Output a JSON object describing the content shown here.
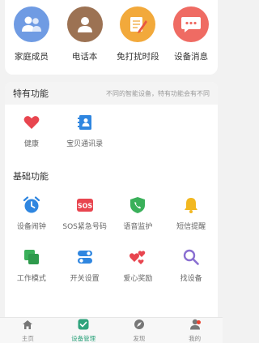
{
  "top_items": [
    {
      "label": "家庭成员",
      "icon": "family-members-icon",
      "color": "#6f9be3"
    },
    {
      "label": "电话本",
      "icon": "phonebook-icon",
      "color": "#9c7253"
    },
    {
      "label": "免打扰时段",
      "icon": "do-not-disturb-icon",
      "color": "#f2a93b"
    },
    {
      "label": "设备消息",
      "icon": "device-message-icon",
      "color": "#ef6b63"
    }
  ],
  "special": {
    "title": "特有功能",
    "desc": "不同的智能设备，特有功能会有不同",
    "items": [
      {
        "label": "健康",
        "icon": "heart-icon"
      },
      {
        "label": "宝贝通讯录",
        "icon": "contacts-book-icon"
      }
    ]
  },
  "basic": {
    "title": "基础功能",
    "items": [
      {
        "label": "设备闹钟",
        "icon": "alarm-clock-icon"
      },
      {
        "label": "SOS紧急号码",
        "icon": "sos-icon"
      },
      {
        "label": "语音监护",
        "icon": "voice-monitor-icon"
      },
      {
        "label": "短信提醒",
        "icon": "bell-icon"
      },
      {
        "label": "工作模式",
        "icon": "work-mode-icon"
      },
      {
        "label": "开关设置",
        "icon": "toggle-switch-icon"
      },
      {
        "label": "爱心奖励",
        "icon": "love-reward-icon"
      },
      {
        "label": "找设备",
        "icon": "search-icon"
      }
    ]
  },
  "tabs": [
    {
      "label": "主页",
      "icon": "home-icon"
    },
    {
      "label": "设备管理",
      "icon": "device-manage-icon"
    },
    {
      "label": "发现",
      "icon": "discover-icon"
    },
    {
      "label": "我的",
      "icon": "profile-icon"
    }
  ],
  "colors": {
    "accent": "#2ea37c",
    "heart": "#e8454f",
    "blue": "#2f86e0",
    "sos": "#e8454f",
    "green": "#3ab05a",
    "yellow": "#f2b820",
    "purple": "#8a6fd1"
  }
}
